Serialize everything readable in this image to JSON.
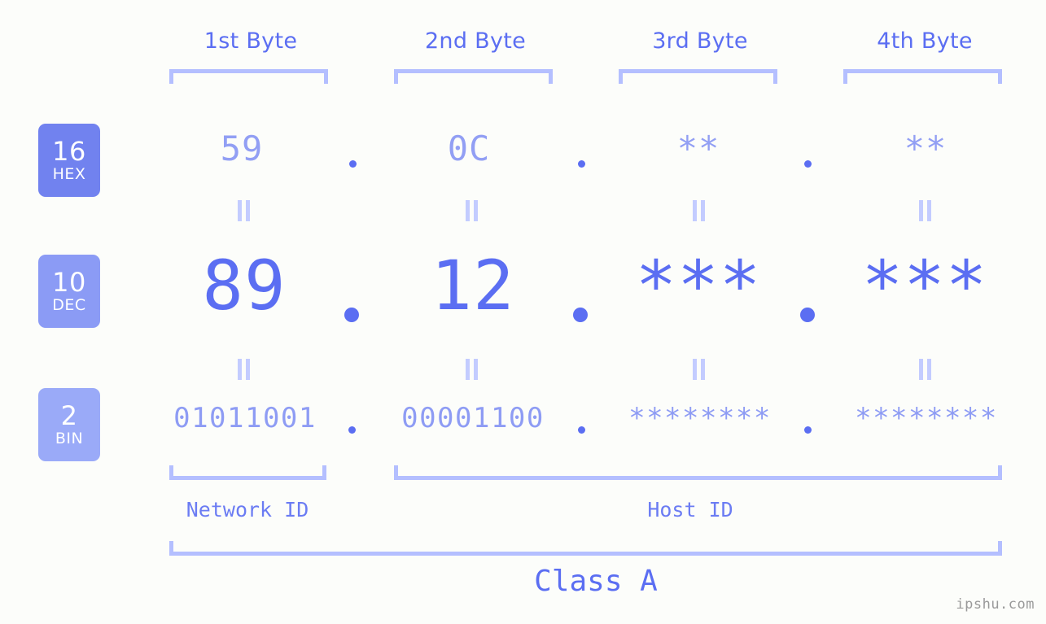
{
  "background": "#fcfdfa",
  "colors": {
    "accent": "#5b6ef2",
    "accent_light": "#929ff4",
    "bracket": "#b4bfff",
    "equals": "#c3ccff",
    "badge_hex": "#7182ef",
    "badge_dec": "#8b9bf5",
    "badge_bin": "#9aaaf8",
    "watermark": "#9a9a9a"
  },
  "header": {
    "bytes": [
      {
        "label": "1st Byte"
      },
      {
        "label": "2nd Byte"
      },
      {
        "label": "3rd Byte"
      },
      {
        "label": "4th Byte"
      }
    ]
  },
  "bases": [
    {
      "id": "hex",
      "number": "16",
      "abbr": "HEX"
    },
    {
      "id": "dec",
      "number": "10",
      "abbr": "DEC"
    },
    {
      "id": "bin",
      "number": "2",
      "abbr": "BIN"
    }
  ],
  "rows": {
    "hex": {
      "values": [
        "59",
        "0C",
        "**",
        "**"
      ],
      "separator": "."
    },
    "dec": {
      "values": [
        "89",
        "12",
        "***",
        "***"
      ],
      "separator": "."
    },
    "bin": {
      "values": [
        "01011001",
        "00001100",
        "********",
        "********"
      ],
      "separator": "."
    }
  },
  "segments": {
    "network_id": "Network ID",
    "host_id": "Host ID"
  },
  "class": {
    "label": "Class A"
  },
  "watermark": "ipshu.com"
}
